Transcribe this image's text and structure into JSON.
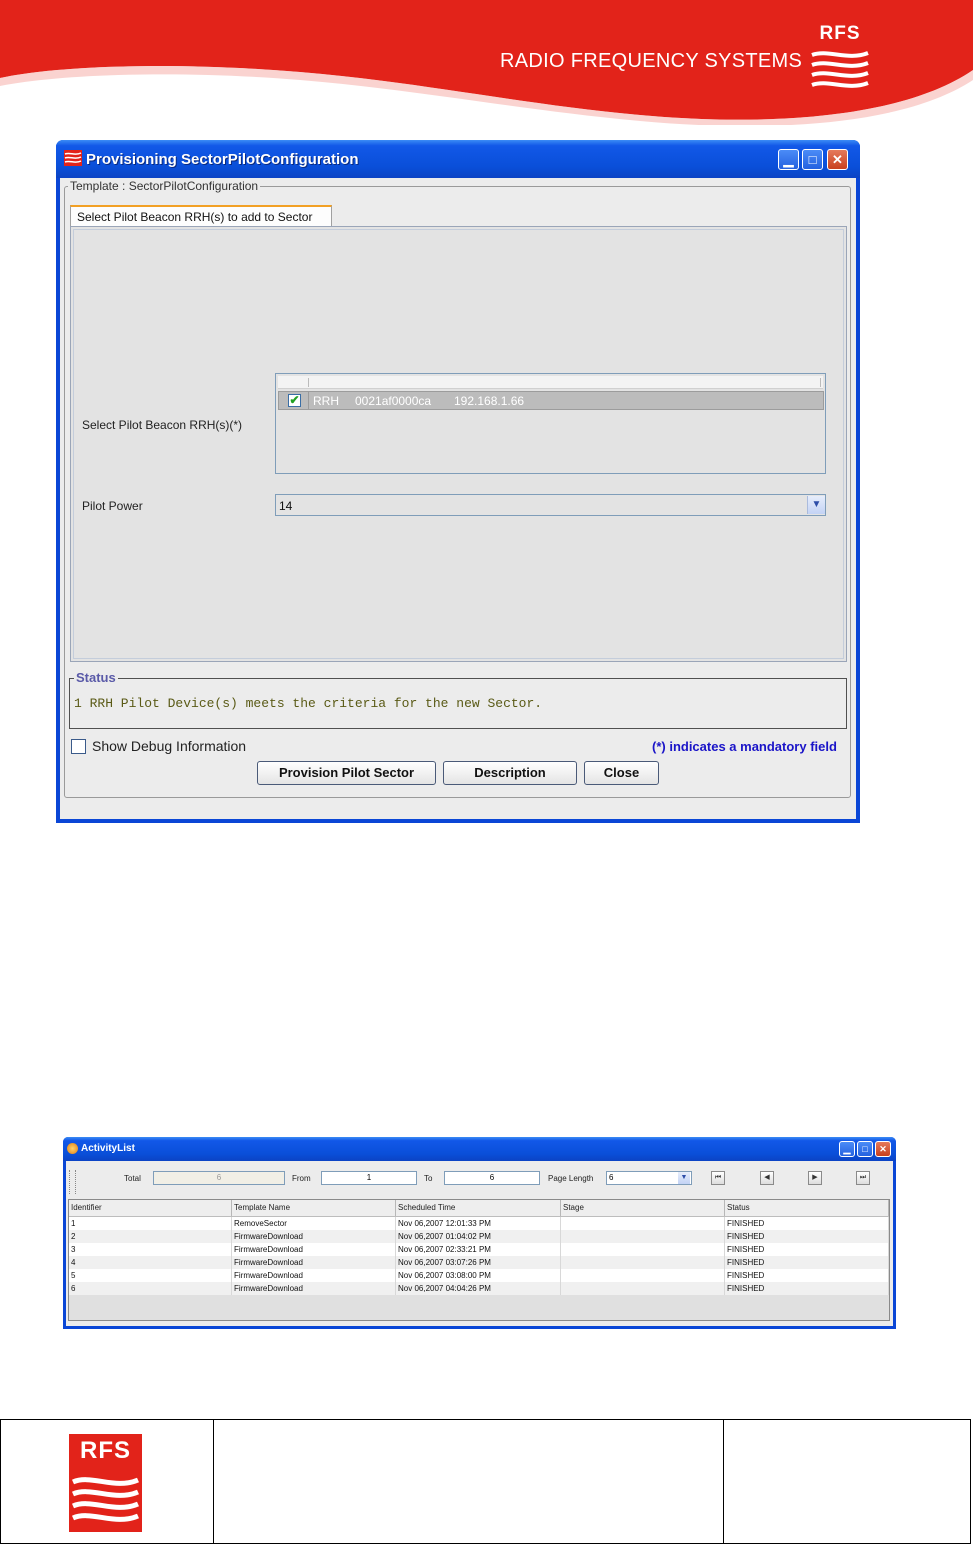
{
  "header": {
    "company_name": "RADIO FREQUENCY SYSTEMS",
    "logo_text": "RFS"
  },
  "provisioning_window": {
    "title": "Provisioning SectorPilotConfiguration",
    "template_group": "Template : SectorPilotConfiguration",
    "tab_label": "Select Pilot Beacon RRH(s) to add to Sector",
    "select_label": "Select Pilot Beacon RRH(s)(*)",
    "rrh_row": {
      "checked": true,
      "type": "RRH",
      "id": "0021af0000ca",
      "ip": "192.168.1.66"
    },
    "pilot_power_label": "Pilot Power",
    "pilot_power_value": "14",
    "status_title": "Status",
    "status_message": "1 RRH Pilot Device(s) meets the criteria for the new Sector.",
    "show_debug_label": "Show Debug Information",
    "show_debug_checked": false,
    "mandatory_note": "(*) indicates a mandatory field",
    "buttons": {
      "provision": "Provision Pilot Sector",
      "description": "Description",
      "close": "Close"
    }
  },
  "activity_window": {
    "title": "ActivityList",
    "total_label": "Total",
    "total_value": "6",
    "from_label": "From",
    "from_value": "1",
    "to_label": "To",
    "to_value": "6",
    "page_length_label": "Page Length",
    "page_length_value": "6",
    "columns": [
      "Identifier",
      "Template Name",
      "Scheduled Time",
      "Stage",
      "Status"
    ],
    "rows": [
      [
        "1",
        "RemoveSector",
        "Nov 06,2007 12:01:33 PM",
        "",
        "FINISHED"
      ],
      [
        "2",
        "FirmwareDownload",
        "Nov 06,2007 01:04:02 PM",
        "",
        "FINISHED"
      ],
      [
        "3",
        "FirmwareDownload",
        "Nov 06,2007 02:33:21 PM",
        "",
        "FINISHED"
      ],
      [
        "4",
        "FirmwareDownload",
        "Nov 06,2007 03:07:26 PM",
        "",
        "FINISHED"
      ],
      [
        "5",
        "FirmwareDownload",
        "Nov 06,2007 03:08:00 PM",
        "",
        "FINISHED"
      ],
      [
        "6",
        "FirmwareDownload",
        "Nov 06,2007 04:04:26 PM",
        "",
        "FINISHED"
      ]
    ]
  },
  "footer": {
    "logo_text": "RFS"
  },
  "colors": {
    "brand_red": "#e2231a",
    "xp_blue": "#0a46d6",
    "mandatory_blue": "#1a14c8",
    "status_text": "#5a5a16"
  }
}
